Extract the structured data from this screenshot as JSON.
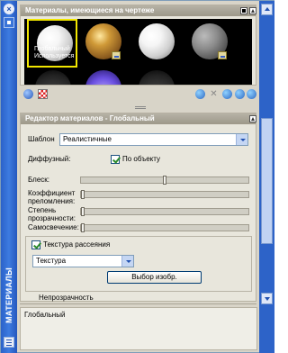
{
  "palette": {
    "side_title": "МАТЕРИАЛЫ",
    "close_glyph": "×"
  },
  "materials_panel": {
    "header": "Материалы, имеющиеся на чертеже",
    "selected_swatch_label_1": "Глобальный",
    "selected_swatch_label_2": "Используется"
  },
  "editor_panel": {
    "header": "Редактор материалов - Глобальный",
    "template_label": "Шаблон",
    "template_value": "Реалистичные",
    "diffuse_label": "Диффузный:",
    "by_object_label": "По объекту",
    "by_object_checked": true,
    "gloss_label": "Блеск:",
    "gloss_value": 0.5,
    "refraction_label_1": "Коэффициент",
    "refraction_label_2": "преломления:",
    "refraction_value": 0.0,
    "transparency_label_1": "Степень",
    "transparency_label_2": "прозрачности:",
    "transparency_value": 0.0,
    "self_illum_label": "Самосвечение:",
    "self_illum_value": 0.0,
    "diffuse_map_label": "Текстура рассеяния",
    "diffuse_map_checked": true,
    "map_type_value": "Текстура",
    "select_image_button": "Выбор изобр.",
    "opacity_label": "Непрозрачность"
  },
  "status_text": "Глобальный",
  "colors": {
    "title_blue": "#2b62c9",
    "selection_yellow": "#f1e600",
    "header_gray": "#a9a597"
  },
  "icons": {
    "toolbar_left": [
      "globe-icon",
      "checker-icon"
    ],
    "toolbar_right": [
      "sphere-icon",
      "delete-icon",
      "apply-icon",
      "tools-icon",
      "purge-icon"
    ]
  }
}
